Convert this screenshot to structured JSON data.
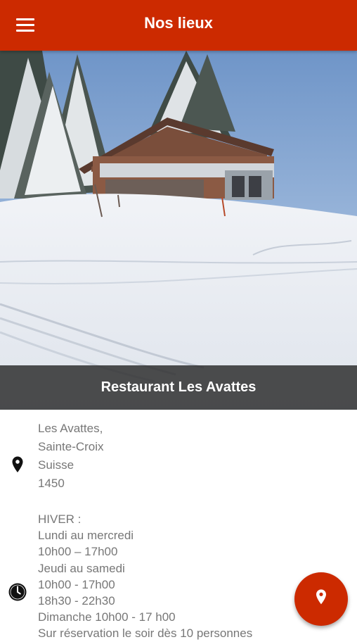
{
  "header": {
    "title": "Nos lieux",
    "menu_icon": "hamburger-menu-icon"
  },
  "place": {
    "name": "Restaurant Les Avattes",
    "address": [
      "Les Avattes,",
      "Sainte-Croix",
      "Suisse",
      "1450"
    ],
    "hours_title": "HIVER :",
    "hours_lines": [
      "Lundi au mercredi",
      "10h00 – 17h00",
      "Jeudi au samedi",
      "10h00 - 17h00",
      "18h30 - 22h30",
      "Dimanche 10h00 - 17 h00",
      "Sur réservation le soir dès 10 personnes"
    ]
  },
  "icons": {
    "address": "location-pin-icon",
    "hours": "clock-icon",
    "fab": "map-pin-icon"
  },
  "colors": {
    "primary": "#cc2a00",
    "text_muted": "#777777",
    "caption_overlay": "#282828"
  }
}
